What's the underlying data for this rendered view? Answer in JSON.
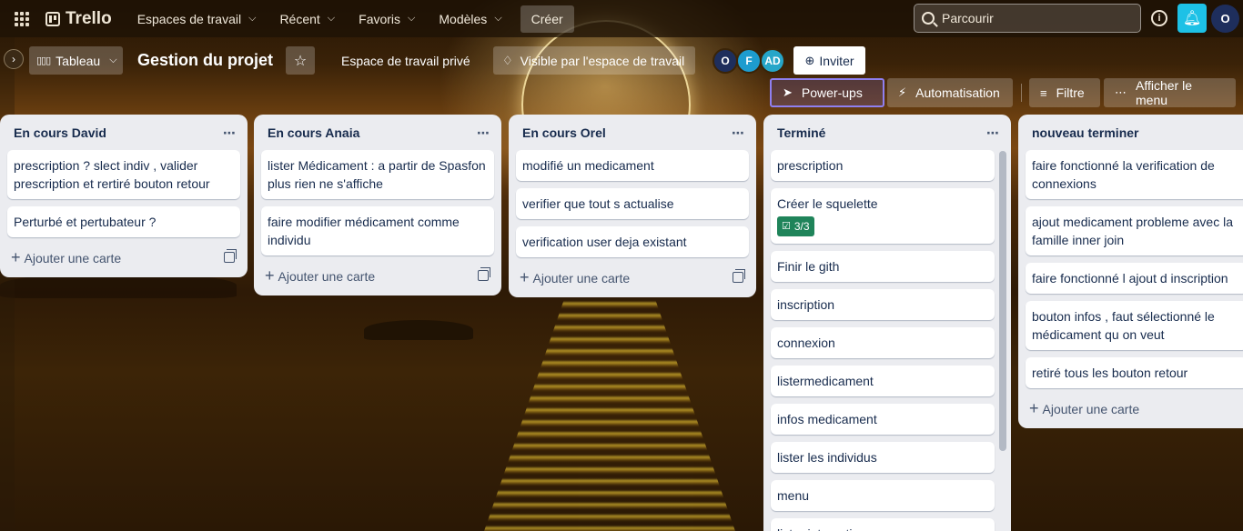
{
  "topbar": {
    "logo": "Trello",
    "nav": [
      {
        "label": "Espaces de travail"
      },
      {
        "label": "Récent"
      },
      {
        "label": "Favoris"
      },
      {
        "label": "Modèles"
      }
    ],
    "create": "Créer",
    "search_placeholder": "Parcourir",
    "avatar": "O"
  },
  "board": {
    "view_label": "Tableau",
    "title": "Gestion du projet",
    "workspace_label": "Espace de travail privé",
    "visibility_label": "Visible par l'espace de travail",
    "members": [
      {
        "initials": "O",
        "color": "#1e2e5c"
      },
      {
        "initials": "F",
        "color": "#1d9ccf"
      },
      {
        "initials": "AD",
        "color": "#26a6c9"
      }
    ],
    "invite_label": "Inviter",
    "powerups_label": "Power-ups",
    "automation_label": "Automatisation",
    "filter_label": "Filtre",
    "menu_label": "Afficher le menu"
  },
  "add_card_label": "Ajouter une carte",
  "lists": [
    {
      "title": "En cours David",
      "cards": [
        {
          "text": "prescription ? slect indiv , valider prescription et rertiré bouton retour"
        },
        {
          "text": "Perturbé et pertubateur ?"
        }
      ]
    },
    {
      "title": "En cours Anaia",
      "cards": [
        {
          "text": "lister Médicament : a partir de Spasfon plus rien ne s'affiche"
        },
        {
          "text": "faire modifier médicament comme individu"
        }
      ]
    },
    {
      "title": "En cours Orel",
      "cards": [
        {
          "text": "modifié un medicament"
        },
        {
          "text": "verifier que tout s actualise"
        },
        {
          "text": "verification user deja existant"
        }
      ]
    },
    {
      "title": "Terminé",
      "cards": [
        {
          "text": "prescription"
        },
        {
          "text": "Créer le squelette",
          "checklist": "3/3"
        },
        {
          "text": "Finir le gith"
        },
        {
          "text": "inscription"
        },
        {
          "text": "connexion"
        },
        {
          "text": "listermedicament"
        },
        {
          "text": "infos medicament"
        },
        {
          "text": "lister les individus"
        },
        {
          "text": "menu"
        },
        {
          "text": "lister interaction"
        }
      ]
    },
    {
      "title": "nouveau terminer",
      "cards": [
        {
          "text": "faire fonctionné la verification de connexions"
        },
        {
          "text": "ajout medicament probleme avec la famille inner join"
        },
        {
          "text": "faire fonctionné l ajout d inscription"
        },
        {
          "text": "bouton infos , faut sélectionné le médicament qu on veut"
        },
        {
          "text": "retiré tous les bouton retour"
        }
      ]
    }
  ]
}
